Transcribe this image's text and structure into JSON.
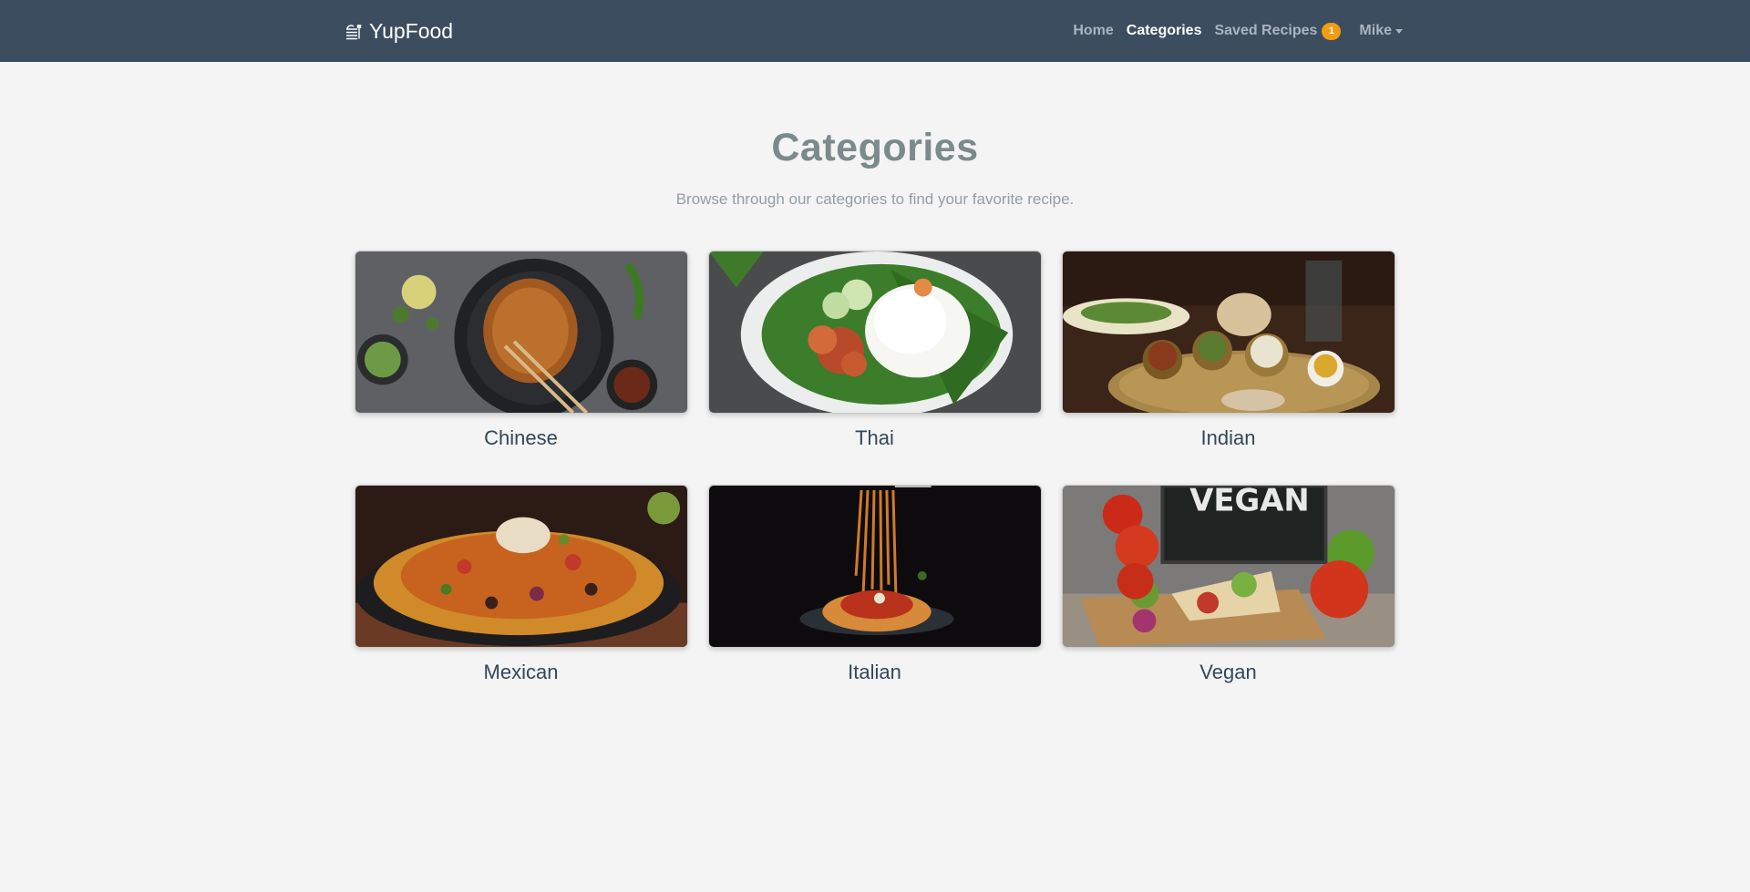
{
  "navbar": {
    "brand": "YupFood",
    "brand_icon": "food-stack-icon",
    "links": [
      {
        "label": "Home"
      },
      {
        "label": "Categories"
      },
      {
        "label": "Saved Recipes",
        "badge": "1"
      },
      {
        "label": "Mike"
      }
    ]
  },
  "hero": {
    "title": "Categories",
    "subtitle": "Browse through our categories to find your favorite recipe."
  },
  "categories": [
    {
      "name": "Chinese"
    },
    {
      "name": "Thai"
    },
    {
      "name": "Indian"
    },
    {
      "name": "Mexican"
    },
    {
      "name": "Italian"
    },
    {
      "name": "Vegan"
    }
  ],
  "colors": {
    "navbar_bg": "#3c4d60",
    "badge": "#f39c12",
    "page_bg": "#f4f4f4",
    "title": "#7b8a8b"
  }
}
